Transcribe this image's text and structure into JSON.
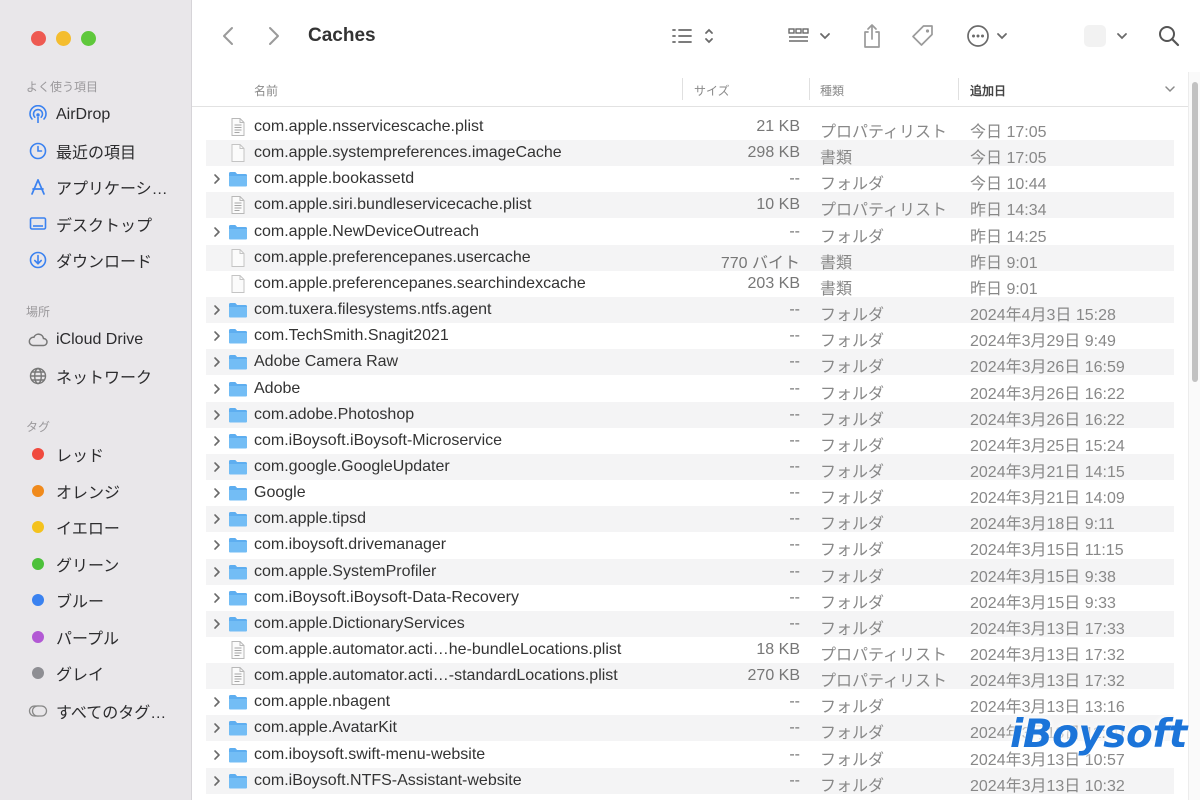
{
  "window": {
    "title": "Caches"
  },
  "sidebar": {
    "favorites_heading": "よく使う項目",
    "favorites": [
      {
        "label": "AirDrop",
        "icon": "airdrop-icon"
      },
      {
        "label": "最近の項目",
        "icon": "clock-icon"
      },
      {
        "label": "アプリケーシ…",
        "icon": "applications-icon"
      },
      {
        "label": "デスクトップ",
        "icon": "desktop-icon"
      },
      {
        "label": "ダウンロード",
        "icon": "download-icon"
      }
    ],
    "locations_heading": "場所",
    "locations": [
      {
        "label": "iCloud Drive",
        "icon": "cloud-icon"
      },
      {
        "label": "ネットワーク",
        "icon": "globe-icon"
      }
    ],
    "tags_heading": "タグ",
    "tags": [
      {
        "label": "レッド",
        "color": "#f04a3e"
      },
      {
        "label": "オレンジ",
        "color": "#f08a1c"
      },
      {
        "label": "イエロー",
        "color": "#f4c21d"
      },
      {
        "label": "グリーン",
        "color": "#4cc13a"
      },
      {
        "label": "ブルー",
        "color": "#3a82f0"
      },
      {
        "label": "パープル",
        "color": "#b259d4"
      },
      {
        "label": "グレイ",
        "color": "#8e8e93"
      },
      {
        "label": "すべてのタグ…",
        "icon": "all-tags-icon"
      }
    ]
  },
  "toolbar": {
    "icons": [
      "back-chevron-icon",
      "forward-chevron-icon",
      "list-view-icon",
      "group-icon",
      "share-icon",
      "tag-icon",
      "more-icon",
      "view-options-icon",
      "search-icon"
    ]
  },
  "columns": {
    "name": "名前",
    "size": "サイズ",
    "kind": "種類",
    "date_added": "追加日"
  },
  "files": [
    {
      "name": "com.apple.nsservicescache.plist",
      "size": "21 KB",
      "kind": "プロパティリスト",
      "date": "今日 17:05",
      "type": "plist"
    },
    {
      "name": "com.apple.systempreferences.imageCache",
      "size": "298 KB",
      "kind": "書類",
      "date": "今日 17:05",
      "type": "doc"
    },
    {
      "name": "com.apple.bookassetd",
      "size": "--",
      "kind": "フォルダ",
      "date": "今日 10:44",
      "type": "folder"
    },
    {
      "name": "com.apple.siri.bundleservicecache.plist",
      "size": "10 KB",
      "kind": "プロパティリスト",
      "date": "昨日 14:34",
      "type": "plist"
    },
    {
      "name": "com.apple.NewDeviceOutreach",
      "size": "--",
      "kind": "フォルダ",
      "date": "昨日 14:25",
      "type": "folder"
    },
    {
      "name": "com.apple.preferencepanes.usercache",
      "size": "770 バイト",
      "kind": "書類",
      "date": "昨日 9:01",
      "type": "doc"
    },
    {
      "name": "com.apple.preferencepanes.searchindexcache",
      "size": "203 KB",
      "kind": "書類",
      "date": "昨日 9:01",
      "type": "doc"
    },
    {
      "name": "com.tuxera.filesystems.ntfs.agent",
      "size": "--",
      "kind": "フォルダ",
      "date": "2024年4月3日 15:28",
      "type": "folder"
    },
    {
      "name": "com.TechSmith.Snagit2021",
      "size": "--",
      "kind": "フォルダ",
      "date": "2024年3月29日 9:49",
      "type": "folder"
    },
    {
      "name": "Adobe Camera Raw",
      "size": "--",
      "kind": "フォルダ",
      "date": "2024年3月26日 16:59",
      "type": "folder"
    },
    {
      "name": "Adobe",
      "size": "--",
      "kind": "フォルダ",
      "date": "2024年3月26日 16:22",
      "type": "folder"
    },
    {
      "name": "com.adobe.Photoshop",
      "size": "--",
      "kind": "フォルダ",
      "date": "2024年3月26日 16:22",
      "type": "folder"
    },
    {
      "name": "com.iBoysoft.iBoysoft-Microservice",
      "size": "--",
      "kind": "フォルダ",
      "date": "2024年3月25日 15:24",
      "type": "folder"
    },
    {
      "name": "com.google.GoogleUpdater",
      "size": "--",
      "kind": "フォルダ",
      "date": "2024年3月21日 14:15",
      "type": "folder"
    },
    {
      "name": "Google",
      "size": "--",
      "kind": "フォルダ",
      "date": "2024年3月21日 14:09",
      "type": "folder"
    },
    {
      "name": "com.apple.tipsd",
      "size": "--",
      "kind": "フォルダ",
      "date": "2024年3月18日 9:11",
      "type": "folder"
    },
    {
      "name": "com.iboysoft.drivemanager",
      "size": "--",
      "kind": "フォルダ",
      "date": "2024年3月15日 11:15",
      "type": "folder"
    },
    {
      "name": "com.apple.SystemProfiler",
      "size": "--",
      "kind": "フォルダ",
      "date": "2024年3月15日 9:38",
      "type": "folder"
    },
    {
      "name": "com.iBoysoft.iBoysoft-Data-Recovery",
      "size": "--",
      "kind": "フォルダ",
      "date": "2024年3月15日 9:33",
      "type": "folder"
    },
    {
      "name": "com.apple.DictionaryServices",
      "size": "--",
      "kind": "フォルダ",
      "date": "2024年3月13日 17:33",
      "type": "folder"
    },
    {
      "name": "com.apple.automator.acti…he-bundleLocations.plist",
      "size": "18 KB",
      "kind": "プロパティリスト",
      "date": "2024年3月13日 17:32",
      "type": "plist"
    },
    {
      "name": "com.apple.automator.acti…-standardLocations.plist",
      "size": "270 KB",
      "kind": "プロパティリスト",
      "date": "2024年3月13日 17:32",
      "type": "plist"
    },
    {
      "name": "com.apple.nbagent",
      "size": "--",
      "kind": "フォルダ",
      "date": "2024年3月13日 13:16",
      "type": "folder"
    },
    {
      "name": "com.apple.AvatarKit",
      "size": "--",
      "kind": "フォルダ",
      "date": "2024年3月13日 11:40",
      "type": "folder"
    },
    {
      "name": "com.iboysoft.swift-menu-website",
      "size": "--",
      "kind": "フォルダ",
      "date": "2024年3月13日 10:57",
      "type": "folder"
    },
    {
      "name": "com.iBoysoft.NTFS-Assistant-website",
      "size": "--",
      "kind": "フォルダ",
      "date": "2024年3月13日 10:32",
      "type": "folder"
    }
  ],
  "watermark": "iBoysoft"
}
